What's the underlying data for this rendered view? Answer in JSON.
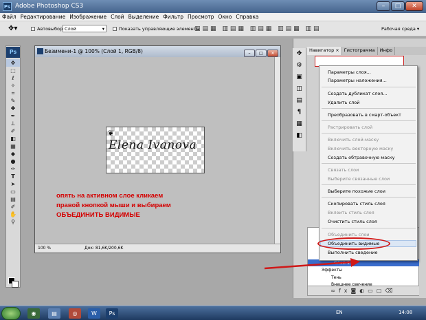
{
  "app": {
    "title": "Adobe Photoshop CS3",
    "logo": "Ps",
    "window_buttons": {
      "min": "–",
      "max": "□",
      "close": "✕"
    }
  },
  "menu": [
    "Файл",
    "Редактирование",
    "Изображение",
    "Слой",
    "Выделение",
    "Фильтр",
    "Просмотр",
    "Окно",
    "Справка"
  ],
  "options_bar": {
    "autoselect_label": "Автовыбор:",
    "autoselect_value": "Слой",
    "show_controls_label": "Показать управляющие элементы",
    "workspace_label": "Рабочая среда ▾"
  },
  "document": {
    "title": "Безимени-1 @ 100% (Слой 1, RGB/8)",
    "zoom": "100 %",
    "doc_size": "Док: 81,6K/200,6K",
    "signature": "Elena Ivanova"
  },
  "annotation": {
    "line1": "опять на активном слое кликаем",
    "line2": "правой кнопкой мыши и выбираем",
    "line3": "ОБЪЕДИНИТЬ ВИДИМЫЕ"
  },
  "panel_tabs": [
    "Навигатор ×",
    "Гистограмма",
    "Инфо"
  ],
  "context_menu": [
    {
      "label": "Параметры слоя...",
      "disabled": false
    },
    {
      "label": "Параметры наложения...",
      "disabled": false
    },
    {
      "label": "Создать дубликат слоя...",
      "disabled": false
    },
    {
      "label": "Удалить слой",
      "disabled": false
    },
    {
      "label": "Преобразовать в смарт-объект",
      "disabled": false
    },
    {
      "label": "Растрировать слой",
      "disabled": true
    },
    {
      "label": "Включить слой-маску",
      "disabled": true
    },
    {
      "label": "Включить векторную маску",
      "disabled": true
    },
    {
      "label": "Создать обтравочную маску",
      "disabled": false
    },
    {
      "label": "Связать слои",
      "disabled": true
    },
    {
      "label": "Выберите связанные слои",
      "disabled": true
    },
    {
      "label": "Выберите похожие слои",
      "disabled": false
    },
    {
      "label": "Скопировать стиль слоя",
      "disabled": false
    },
    {
      "label": "Вклеить стиль слоя",
      "disabled": true
    },
    {
      "label": "Очистить стиль слоя",
      "disabled": false
    },
    {
      "label": "Объединить слои",
      "disabled": true
    },
    {
      "label": "Объединить видимые",
      "disabled": false
    },
    {
      "label": "Выполнить сведение",
      "disabled": false
    }
  ],
  "layers": {
    "selected": "Слой 1",
    "effects": "Эффекты",
    "shadow": "Тень",
    "outer_glow": "Внешнее свечение"
  },
  "taskbar": {
    "lang": "EN",
    "time": "14:08"
  },
  "colors": {
    "annotation": "#d40000",
    "highlight_oval": "#d01818",
    "selected_layer": "#3a6ccc"
  }
}
